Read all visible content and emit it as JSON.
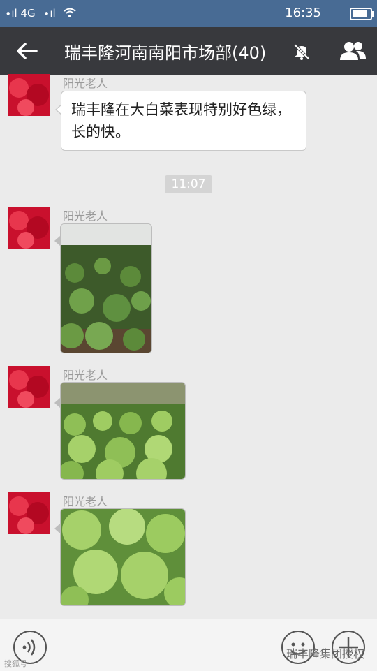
{
  "status_bar": {
    "signal1": "∙ıl 4G",
    "signal2": "∙ıl",
    "time": "16:35",
    "battery_level": 0.85
  },
  "title_bar": {
    "title": "瑞丰隆河南南阳市场部(40)"
  },
  "messages": [
    {
      "sender": "阳光老人",
      "text": "瑞丰隆在大白菜表现特别好色绿，长的快。"
    },
    {
      "timestamp": "11:07"
    },
    {
      "sender": "阳光老人",
      "type": "image"
    },
    {
      "sender": "阳光老人",
      "type": "image"
    },
    {
      "sender": "阳光老人",
      "type": "image"
    }
  ],
  "bottom_bar": {
    "watermark": "瑞丰隆集团授权",
    "corner_watermark": "搜狐号"
  },
  "colors": {
    "status_bar": "#486b94",
    "title_bar": "#38393d",
    "chat_bg": "#ebebeb",
    "bubble": "#ffffff"
  }
}
